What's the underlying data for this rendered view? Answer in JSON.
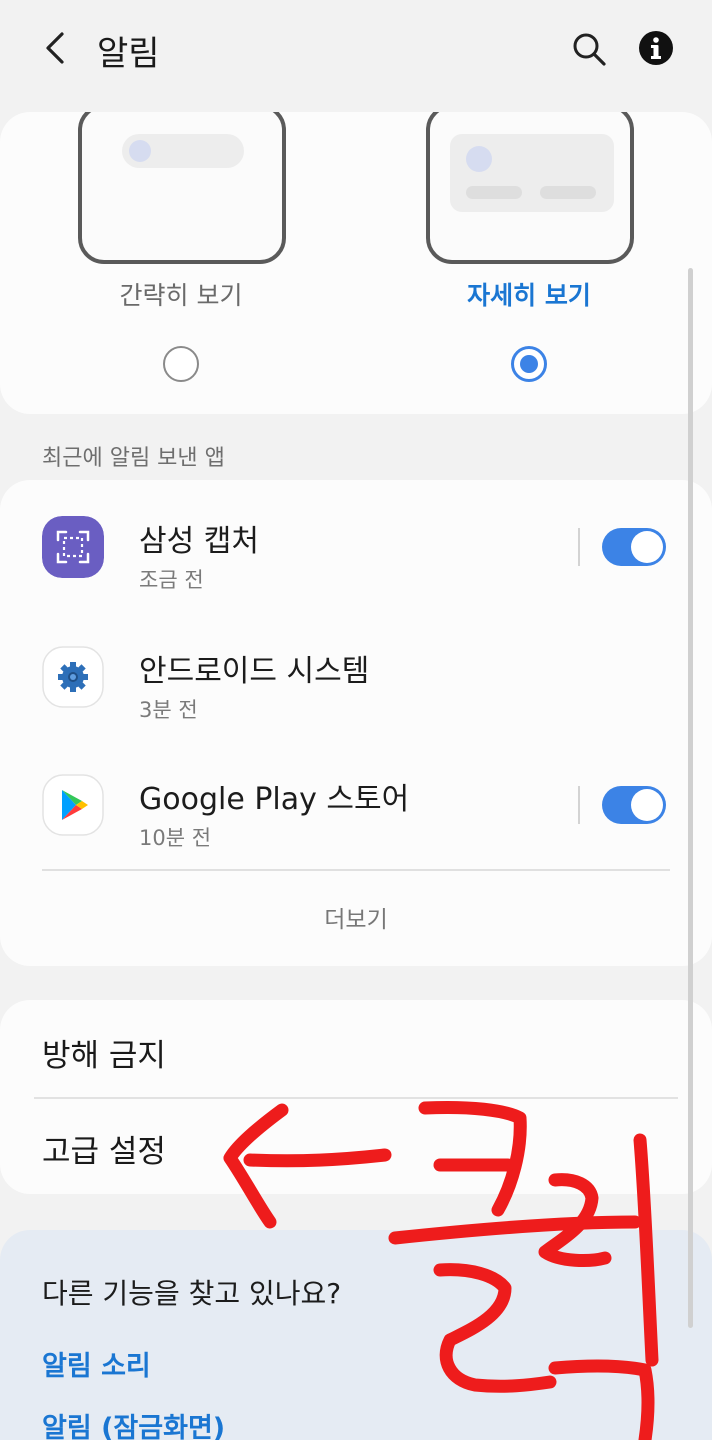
{
  "header": {
    "title": "알림"
  },
  "style_picker": {
    "brief_label": "간략히 보기",
    "detail_label": "자세히 보기",
    "selected": "자세히 보기"
  },
  "recent_section": {
    "title": "최근에 알림 보낸 앱",
    "apps": [
      {
        "name": "삼성 캡처",
        "time": "조금 전",
        "toggle_on": true,
        "icon": "samsung-capture-icon"
      },
      {
        "name": "안드로이드 시스템",
        "time": "3분 전",
        "icon": "android-system-gear-icon"
      },
      {
        "name": "Google Play 스토어",
        "time": "10분 전",
        "toggle_on": true,
        "icon": "google-play-icon"
      }
    ],
    "more_label": "더보기"
  },
  "settings": {
    "dnd_label": "방해 금지",
    "advanced_label": "고급 설정"
  },
  "suggestions": {
    "question": "다른 기능을 찾고 있나요?",
    "links": [
      "알림 소리",
      "알림 (잠금화면)"
    ]
  },
  "annotation": {
    "handwritten_text": "클릭",
    "color": "#ee1c1c"
  },
  "colors": {
    "accent": "#1a76d2",
    "toggle": "#3c83e6"
  }
}
